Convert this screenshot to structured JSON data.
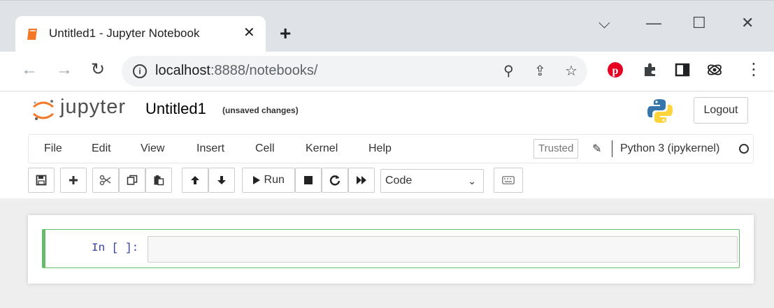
{
  "browser": {
    "tab_title": "Untitled1 - Jupyter Notebook",
    "close_glyph": "✕",
    "newtab_glyph": "+",
    "win_dropdown": "⌵",
    "win_minimize": "—",
    "win_maximize": "☐",
    "win_close": "✕",
    "url_host": "localhost",
    "url_path": ":8888/notebooks/",
    "back_glyph": "←",
    "forward_glyph": "→",
    "reload_glyph": "↻",
    "info_glyph": "i",
    "zoom_glyph": "⚲",
    "share_glyph": "⇪",
    "star_glyph": "☆",
    "menu_glyph": "⋮",
    "colors": {
      "tabstrip": "#dfe3e8",
      "pinterest": "#e60023"
    }
  },
  "jupyter": {
    "logo_text": "jupyter",
    "notebook_title": "Untitled1",
    "save_status": "(unsaved changes)",
    "logout_label": "Logout",
    "menu": [
      "File",
      "Edit",
      "View",
      "Insert",
      "Cell",
      "Kernel",
      "Help"
    ],
    "trusted_label": "Trusted",
    "kernel_name": "Python 3 (ipykernel)",
    "toolbar": {
      "run_label": "Run",
      "cell_type": "Code"
    },
    "cell": {
      "prompt": "In [ ]:"
    },
    "colors": {
      "logo_orange": "#f37726",
      "cell_border": "#66bb6a",
      "prompt": "#303f9f"
    }
  }
}
